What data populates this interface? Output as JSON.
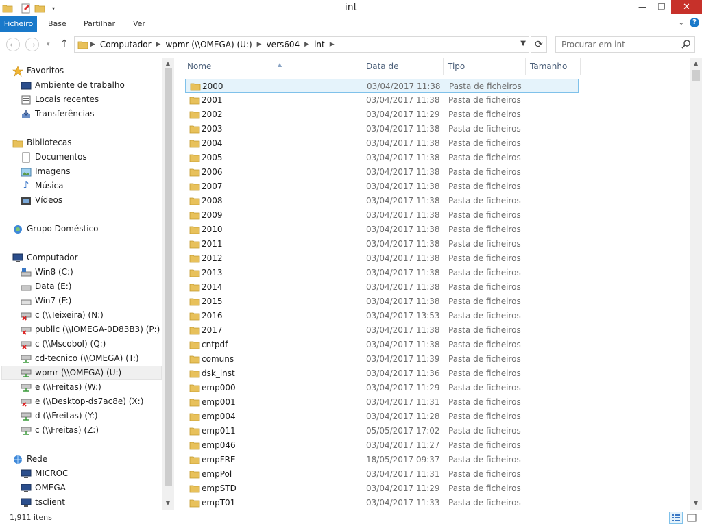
{
  "window": {
    "title": "int"
  },
  "ribbon": {
    "tabs": [
      "Ficheiro",
      "Base",
      "Partilhar",
      "Ver"
    ]
  },
  "address": {
    "crumbs": [
      "Computador",
      "wpmr (\\\\OMEGA) (U:)",
      "vers604",
      "int"
    ],
    "search_placeholder": "Procurar em int"
  },
  "nav": {
    "favorites": {
      "label": "Favoritos",
      "items": [
        "Ambiente de trabalho",
        "Locais recentes",
        "Transferências"
      ]
    },
    "libraries": {
      "label": "Bibliotecas",
      "items": [
        "Documentos",
        "Imagens",
        "Música",
        "Vídeos"
      ]
    },
    "homegroup": {
      "label": "Grupo Doméstico"
    },
    "computer": {
      "label": "Computador",
      "items": [
        "Win8 (C:)",
        "Data (E:)",
        "Win7 (F:)",
        "c (\\\\Teixeira) (N:)",
        "public (\\\\IOMEGA-0D83B3) (P:)",
        "c (\\\\Mscobol) (Q:)",
        "cd-tecnico (\\\\OMEGA) (T:)",
        "wpmr (\\\\OMEGA) (U:)",
        "e (\\\\Freitas) (W:)",
        "e (\\\\Desktop-ds7ac8e) (X:)",
        "d (\\\\Freitas) (Y:)",
        "c (\\\\Freitas) (Z:)"
      ]
    },
    "network": {
      "label": "Rede",
      "items": [
        "MICROC",
        "OMEGA",
        "tsclient"
      ]
    }
  },
  "columns": {
    "name": "Nome",
    "date": "Data de modificaç...",
    "type": "Tipo",
    "size": "Tamanho"
  },
  "files": [
    {
      "name": "2000",
      "date": "03/04/2017 11:38",
      "type": "Pasta de ficheiros"
    },
    {
      "name": "2001",
      "date": "03/04/2017 11:38",
      "type": "Pasta de ficheiros"
    },
    {
      "name": "2002",
      "date": "03/04/2017 11:29",
      "type": "Pasta de ficheiros"
    },
    {
      "name": "2003",
      "date": "03/04/2017 11:38",
      "type": "Pasta de ficheiros"
    },
    {
      "name": "2004",
      "date": "03/04/2017 11:38",
      "type": "Pasta de ficheiros"
    },
    {
      "name": "2005",
      "date": "03/04/2017 11:38",
      "type": "Pasta de ficheiros"
    },
    {
      "name": "2006",
      "date": "03/04/2017 11:38",
      "type": "Pasta de ficheiros"
    },
    {
      "name": "2007",
      "date": "03/04/2017 11:38",
      "type": "Pasta de ficheiros"
    },
    {
      "name": "2008",
      "date": "03/04/2017 11:38",
      "type": "Pasta de ficheiros"
    },
    {
      "name": "2009",
      "date": "03/04/2017 11:38",
      "type": "Pasta de ficheiros"
    },
    {
      "name": "2010",
      "date": "03/04/2017 11:38",
      "type": "Pasta de ficheiros"
    },
    {
      "name": "2011",
      "date": "03/04/2017 11:38",
      "type": "Pasta de ficheiros"
    },
    {
      "name": "2012",
      "date": "03/04/2017 11:38",
      "type": "Pasta de ficheiros"
    },
    {
      "name": "2013",
      "date": "03/04/2017 11:38",
      "type": "Pasta de ficheiros"
    },
    {
      "name": "2014",
      "date": "03/04/2017 11:38",
      "type": "Pasta de ficheiros"
    },
    {
      "name": "2015",
      "date": "03/04/2017 11:38",
      "type": "Pasta de ficheiros"
    },
    {
      "name": "2016",
      "date": "03/04/2017 13:53",
      "type": "Pasta de ficheiros"
    },
    {
      "name": "2017",
      "date": "03/04/2017 11:38",
      "type": "Pasta de ficheiros"
    },
    {
      "name": "cntpdf",
      "date": "03/04/2017 11:38",
      "type": "Pasta de ficheiros"
    },
    {
      "name": "comuns",
      "date": "03/04/2017 11:39",
      "type": "Pasta de ficheiros"
    },
    {
      "name": "dsk_inst",
      "date": "03/04/2017 11:36",
      "type": "Pasta de ficheiros"
    },
    {
      "name": "emp000",
      "date": "03/04/2017 11:29",
      "type": "Pasta de ficheiros"
    },
    {
      "name": "emp001",
      "date": "03/04/2017 11:31",
      "type": "Pasta de ficheiros"
    },
    {
      "name": "emp004",
      "date": "03/04/2017 11:28",
      "type": "Pasta de ficheiros"
    },
    {
      "name": "emp011",
      "date": "05/05/2017 17:02",
      "type": "Pasta de ficheiros"
    },
    {
      "name": "emp046",
      "date": "03/04/2017 11:27",
      "type": "Pasta de ficheiros"
    },
    {
      "name": "empFRE",
      "date": "18/05/2017 09:37",
      "type": "Pasta de ficheiros"
    },
    {
      "name": "empPol",
      "date": "03/04/2017 11:31",
      "type": "Pasta de ficheiros"
    },
    {
      "name": "empSTD",
      "date": "03/04/2017 11:29",
      "type": "Pasta de ficheiros"
    },
    {
      "name": "empT01",
      "date": "03/04/2017 11:33",
      "type": "Pasta de ficheiros"
    }
  ],
  "status": {
    "count": "1,911 itens"
  },
  "colors": {
    "accent": "#1979ca",
    "close": "#c7312a",
    "folder": "#e8c15b",
    "selection": "#e5f3fb"
  }
}
